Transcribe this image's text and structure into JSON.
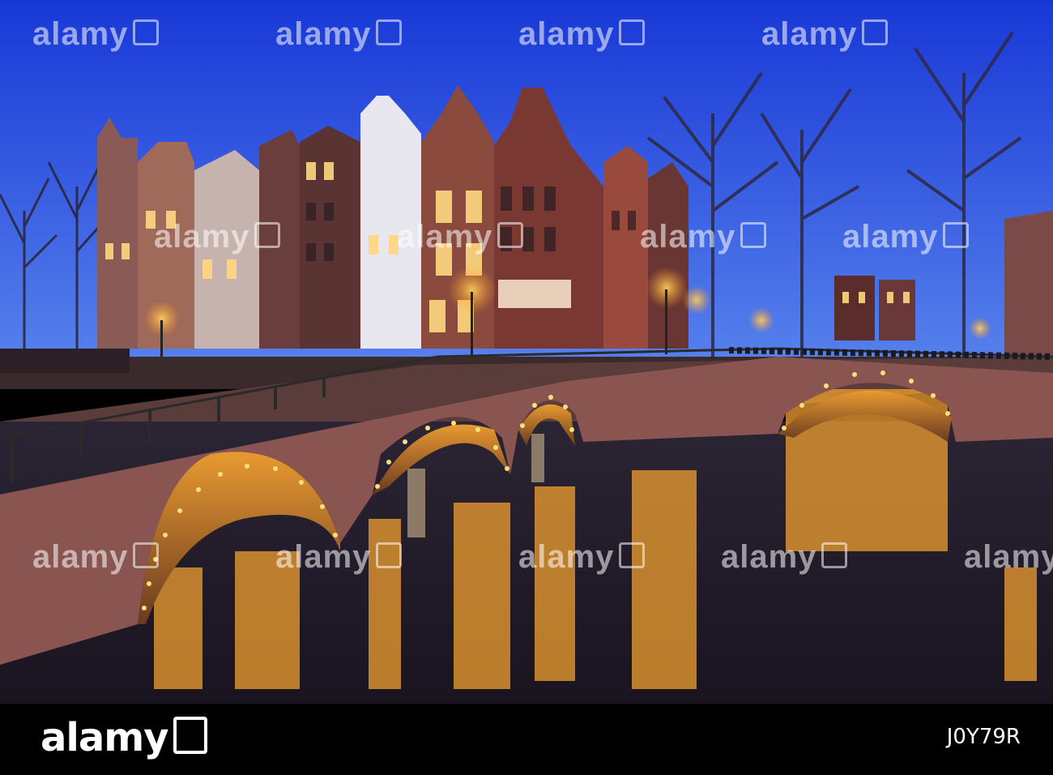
{
  "watermark": {
    "text": "alamy"
  },
  "footer": {
    "logo_text": "alamy",
    "image_id": "J0Y79R"
  },
  "colors": {
    "sky_top": "#1b3fd8",
    "sky_bottom": "#4f7ef0",
    "brick": "#7a4a44",
    "lamp": "#ffc640",
    "water": "#241c2c"
  }
}
